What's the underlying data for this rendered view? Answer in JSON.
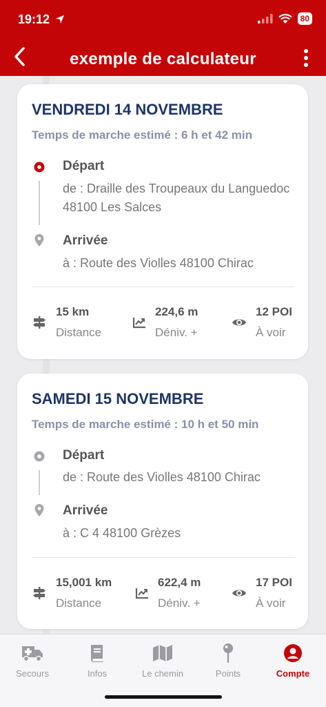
{
  "status": {
    "time": "19:12",
    "battery": "80"
  },
  "header": {
    "title": "exemple de calculateur"
  },
  "stages": [
    {
      "date": "VENDREDI 14 NOVEMBRE",
      "walk_time": "Temps de marche estimé : 6 h et 42 min",
      "departure": {
        "label": "Départ",
        "address": "de : Draille des Troupeaux du Languedoc 48100 Les Salces"
      },
      "arrival": {
        "label": "Arrivée",
        "address": "à : Route des Violles 48100 Chirac"
      },
      "stats": {
        "distance": {
          "value": "15 km",
          "label": "Distance"
        },
        "elevation": {
          "value": "224,6 m",
          "label": "Déniv. +"
        },
        "poi": {
          "value": "12 POI",
          "label": "À voir"
        }
      }
    },
    {
      "date": "SAMEDI 15 NOVEMBRE",
      "walk_time": "Temps de marche estimé : 10 h et 50 min",
      "departure": {
        "label": "Départ",
        "address": "de : Route des Violles 48100 Chirac"
      },
      "arrival": {
        "label": "Arrivée",
        "address": "à : C 4 48100 Grèzes"
      },
      "stats": {
        "distance": {
          "value": "15,001 km",
          "label": "Distance"
        },
        "elevation": {
          "value": "622,4 m",
          "label": "Déniv. +"
        },
        "poi": {
          "value": "17 POI",
          "label": "À voir"
        }
      }
    }
  ],
  "tabs": [
    {
      "label": "Secours",
      "icon": "ambulance-icon",
      "active": false
    },
    {
      "label": "Infos",
      "icon": "book-icon",
      "active": false
    },
    {
      "label": "Le chemin",
      "icon": "map-icon",
      "active": false
    },
    {
      "label": "Points",
      "icon": "pin-icon",
      "active": false
    },
    {
      "label": "Compte",
      "icon": "account-icon",
      "active": true
    }
  ],
  "colors": {
    "brand_red": "#c40508",
    "title_navy": "#1e3466",
    "subtitle_gray": "#8a90a8"
  }
}
